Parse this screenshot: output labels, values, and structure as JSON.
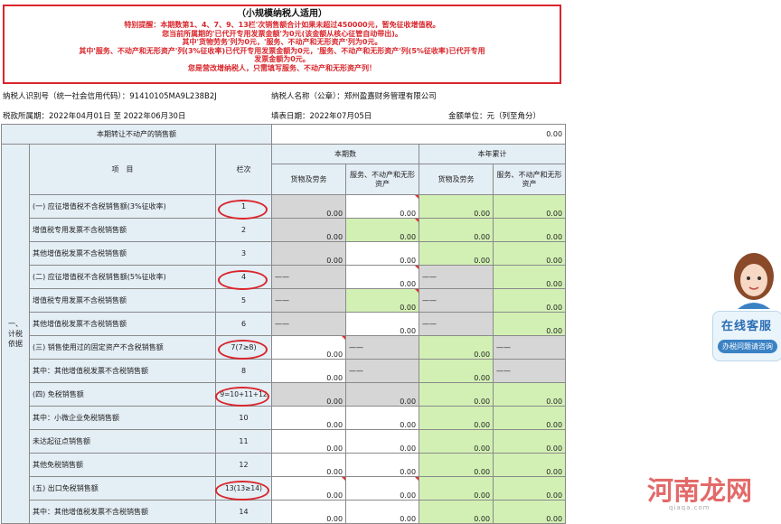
{
  "notice": {
    "title": "（小规模纳税人适用）",
    "lines": [
      "特别提醒：本期数第1、4、7、9、13栏'次销售额合计如果未超过450000元，暂免征收增值税。",
      "您当前所属期的'已代开专用发票金额'为0元(该金额从核心征管自动带出)。",
      "其中'货物劳务'列为0元，'服务、不动产和无形资产'列为0元。",
      "其中'服务、不动产和无形资产'列(3%征收率)已代开专用发票金额为0元，'服务、不动产和无形资产'列(5%征收率)已代开专用",
      "发票金额为0元。",
      "您是营改增纳税人，只需填写服务、不动产和无形资产列！"
    ]
  },
  "taxpayer": {
    "id_label": "纳税人识别号（统一社会信用代码）：",
    "id_value": "91410105MA9L238B2J",
    "name_label": "纳税人名称（公章）：",
    "name_value": "郑州盈嘉财务管理有限公司"
  },
  "period": {
    "label": "税款所属期：",
    "value": "2022年04月01日 至 2022年06月30日",
    "fill_date_label": "填表日期：",
    "fill_date": "2022年07月05日",
    "unit_label": "金额单位：",
    "unit": "元（列至角分）"
  },
  "top_row": {
    "label": "本期转让不动产的销售额",
    "value": "0.00"
  },
  "headers": {
    "section": "一、计税依据",
    "item": "项　目",
    "col": "栏次",
    "current": "本期数",
    "ytd": "本年累计",
    "goods": "货物及劳务",
    "services": "服务、不动产和无形资产"
  },
  "rows": [
    {
      "label": "(一) 应征增值税不含税销售额(3%征收率)",
      "col": "1",
      "vals": [
        "0.00",
        "0.00",
        "0.00",
        "0.00"
      ]
    },
    {
      "label": "增值税专用发票不含税销售额",
      "col": "2",
      "vals": [
        "0.00",
        "0.00",
        "0.00",
        "0.00"
      ]
    },
    {
      "label": "其他增值税发票不含税销售额",
      "col": "3",
      "vals": [
        "0.00",
        "0.00",
        "0.00",
        "0.00"
      ]
    },
    {
      "label": "(二) 应征增值税不含税销售额(5%征收率)",
      "col": "4",
      "vals": [
        "——",
        "0.00",
        "——",
        "0.00"
      ]
    },
    {
      "label": "增值税专用发票不含税销售额",
      "col": "5",
      "vals": [
        "——",
        "0.00",
        "——",
        "0.00"
      ]
    },
    {
      "label": "其他增值税发票不含税销售额",
      "col": "6",
      "vals": [
        "——",
        "0.00",
        "——",
        "0.00"
      ]
    },
    {
      "label": "(三) 销售使用过的固定资产不含税销售额",
      "col": "7(7≥8)",
      "vals": [
        "0.00",
        "——",
        "0.00",
        "——"
      ]
    },
    {
      "label": "其中：其他增值税发票不含税销售额",
      "col": "8",
      "vals": [
        "0.00",
        "——",
        "0.00",
        "——"
      ]
    },
    {
      "label": "(四) 免税销售额",
      "col": "9=10+11+12",
      "vals": [
        "0.00",
        "0.00",
        "0.00",
        "0.00"
      ]
    },
    {
      "label": "其中：小微企业免税销售额",
      "col": "10",
      "vals": [
        "0.00",
        "0.00",
        "0.00",
        "0.00"
      ]
    },
    {
      "label": "未达起征点销售额",
      "col": "11",
      "vals": [
        "0.00",
        "0.00",
        "0.00",
        "0.00"
      ]
    },
    {
      "label": "其他免税销售额",
      "col": "12",
      "vals": [
        "0.00",
        "0.00",
        "0.00",
        "0.00"
      ]
    },
    {
      "label": "(五) 出口免税销售额",
      "col": "13(13≥14)",
      "vals": [
        "0.00",
        "0.00",
        "0.00",
        "0.00"
      ]
    },
    {
      "label": "其中：其他增值税发票不含税销售额",
      "col": "14",
      "vals": [
        "0.00",
        "0.00",
        "0.00",
        "0.00"
      ]
    }
  ],
  "service_widget": {
    "title": "在线客服",
    "subtitle": "办税问题请咨询"
  },
  "watermark": {
    "text": "河南龙网",
    "site": "qiaqa.com"
  }
}
